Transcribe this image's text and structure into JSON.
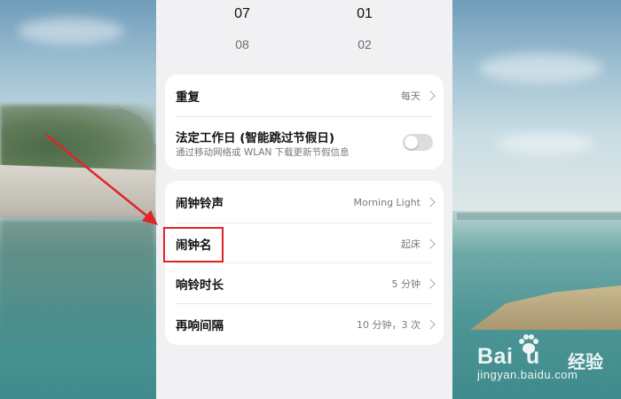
{
  "time_picker": {
    "current": {
      "hour": "07",
      "minute": "01"
    },
    "next": {
      "hour": "08",
      "minute": "02"
    }
  },
  "settings_card_1": {
    "repeat": {
      "label": "重复",
      "value": "每天"
    },
    "workday": {
      "label": "法定工作日 (智能跳过节假日)",
      "description": "通过移动网络或 WLAN 下载更新节假信息",
      "enabled": false
    }
  },
  "settings_card_2": {
    "ringtone": {
      "label": "闹钟铃声",
      "value": "Morning Light"
    },
    "alarm_name": {
      "label": "闹钟名",
      "value": "起床"
    },
    "ring_duration": {
      "label": "响铃时长",
      "value": "5 分钟"
    },
    "snooze_interval": {
      "label": "再响间隔",
      "value": "10 分钟，3 次"
    }
  },
  "annotation": {
    "highlight_color": "#e0242a",
    "target": "闹钟名"
  },
  "watermark": {
    "brand": "Baidu",
    "product": "经验",
    "url": "jingyan.baidu.com"
  },
  "colors": {
    "panel_bg": "#f1f1f4",
    "card_bg": "#ffffff",
    "toggle_off": "#dcdcdf"
  }
}
